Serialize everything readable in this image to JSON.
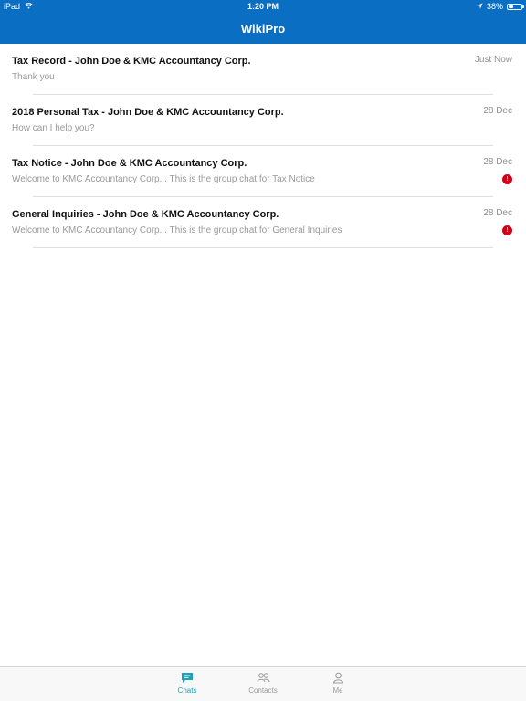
{
  "status_bar": {
    "device": "iPad",
    "time": "1:20 PM",
    "battery": "38%",
    "battery_level": 0.38
  },
  "nav": {
    "title": "WikiPro"
  },
  "chats": [
    {
      "title": "Tax Record - John Doe & KMC Accountancy Corp.",
      "preview": "Thank you",
      "time": "Just Now",
      "badge": ""
    },
    {
      "title": "2018 Personal Tax - John Doe & KMC Accountancy Corp.",
      "preview": "How can I help you?",
      "time": "28 Dec",
      "badge": ""
    },
    {
      "title": "Tax Notice - John Doe & KMC Accountancy Corp.",
      "preview": "Welcome to KMC Accountancy Corp. . This is the group chat for Tax Notice",
      "time": "28 Dec",
      "badge": "!"
    },
    {
      "title": "General Inquiries - John Doe & KMC Accountancy Corp.",
      "preview": "Welcome to KMC Accountancy Corp. . This is the group chat for General Inquiries",
      "time": "28 Dec",
      "badge": "!"
    }
  ],
  "tabs": {
    "chats": "Chats",
    "contacts": "Contacts",
    "me": "Me"
  },
  "colors": {
    "header": "#0a6fc2",
    "active_tab": "#1aa2b8",
    "badge": "#d0021b"
  },
  "icons": {
    "wifi": "wifi-icon",
    "location": "location-arrow-icon",
    "battery": "battery-icon",
    "chats": "chat-bubble-icon",
    "contacts": "people-icon",
    "me": "person-icon"
  }
}
